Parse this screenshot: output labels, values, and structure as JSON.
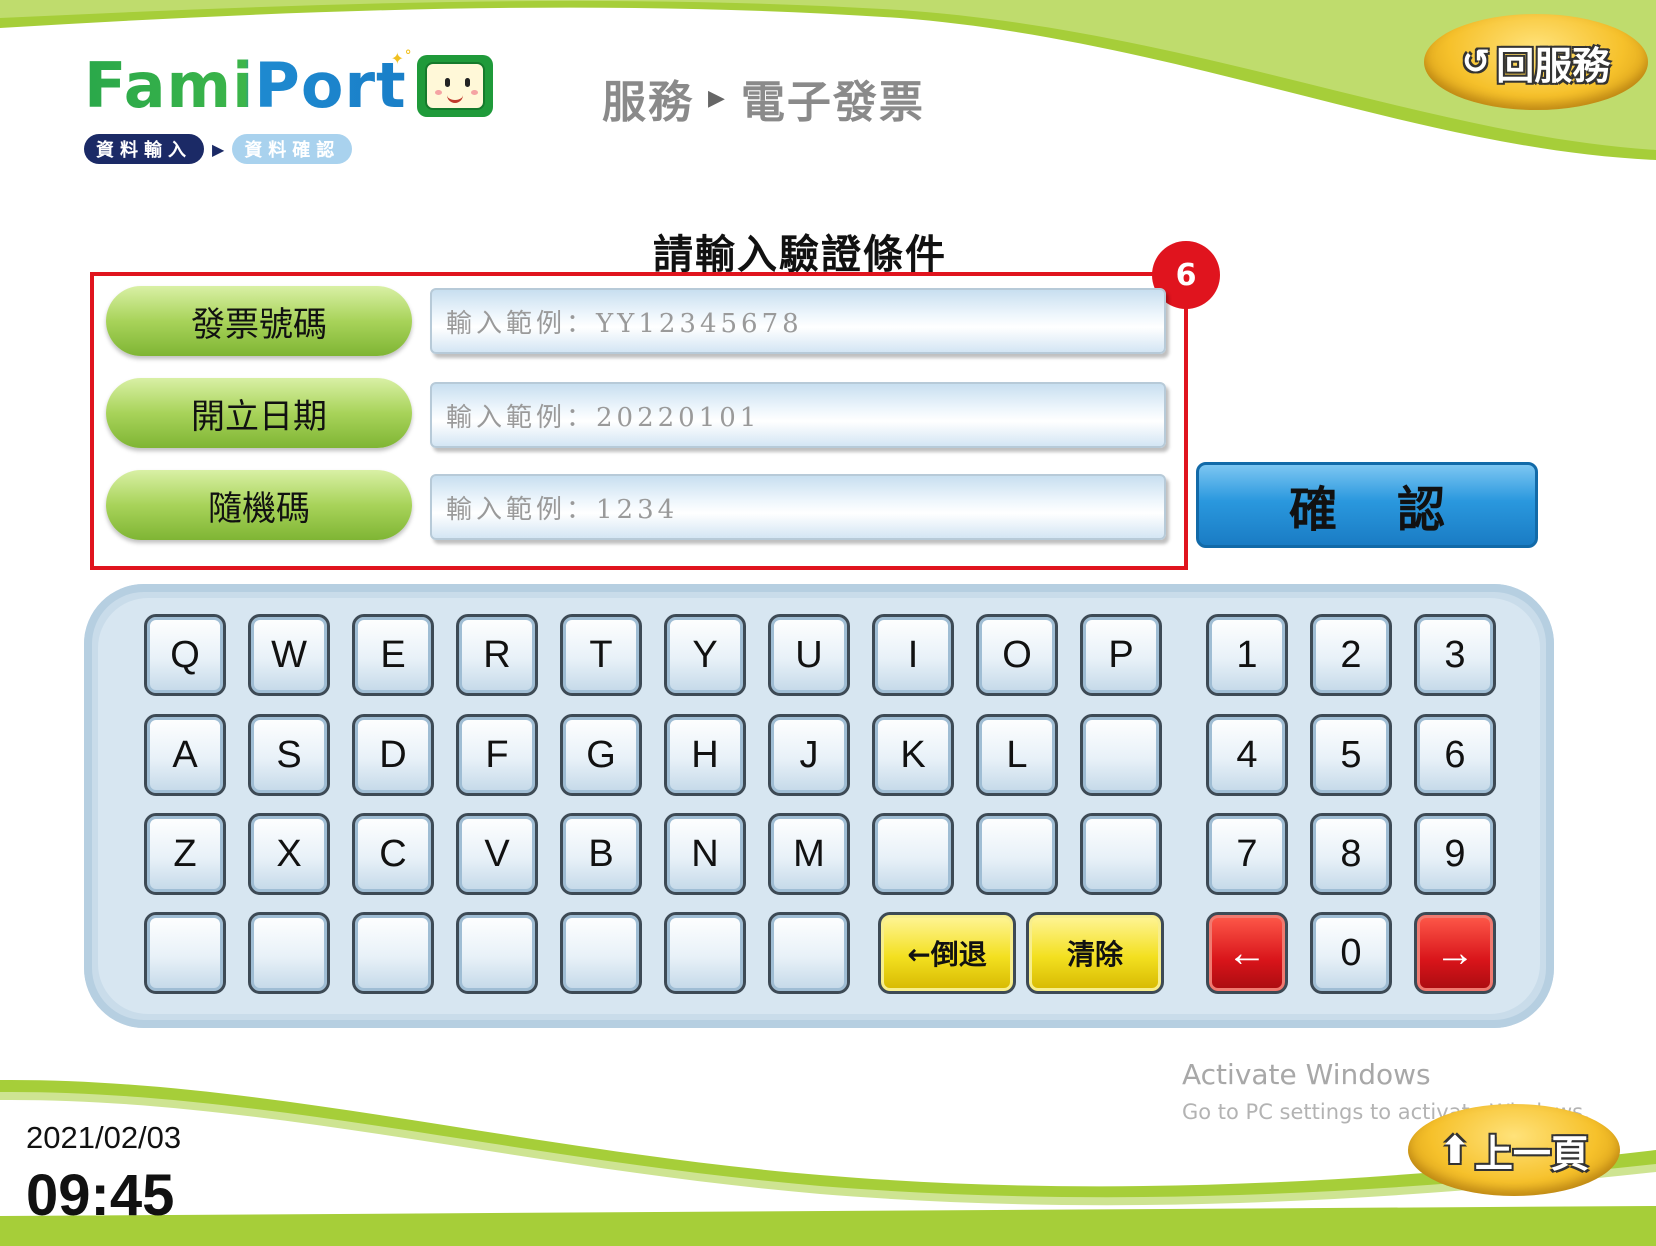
{
  "header": {
    "logo_text": "FamiPort",
    "breadcrumb": [
      "服務",
      "電子發票"
    ],
    "steps": [
      "資料輸入",
      "資料確認"
    ],
    "home_button": "回服務"
  },
  "form": {
    "title": "請輸入驗證條件",
    "badge": "6",
    "fields": [
      {
        "label": "發票號碼",
        "placeholder": "輸入範例：YY12345678"
      },
      {
        "label": "開立日期",
        "placeholder": "輸入範例：20220101"
      },
      {
        "label": "隨機碼",
        "placeholder": "輸入範例：1234"
      }
    ],
    "confirm": [
      "確",
      "認"
    ]
  },
  "keyboard": {
    "rows": [
      [
        "Q",
        "W",
        "E",
        "R",
        "T",
        "Y",
        "U",
        "I",
        "O",
        "P"
      ],
      [
        "A",
        "S",
        "D",
        "F",
        "G",
        "H",
        "J",
        "K",
        "L",
        ""
      ],
      [
        "Z",
        "X",
        "C",
        "V",
        "B",
        "N",
        "M",
        "",
        "",
        ""
      ],
      [
        "",
        "",
        "",
        "",
        "",
        "",
        ""
      ]
    ],
    "numpad": [
      [
        "1",
        "2",
        "3"
      ],
      [
        "4",
        "5",
        "6"
      ],
      [
        "7",
        "8",
        "9"
      ],
      [
        "←",
        "0",
        "→"
      ]
    ],
    "backspace": "←倒退",
    "clear": "清除"
  },
  "footer": {
    "date": "2021/02/03",
    "time": "09:45",
    "back_button": "上一頁",
    "watermark_title": "Activate Windows",
    "watermark_sub": "Go to PC settings to activate Windows."
  },
  "colors": {
    "green": "#8cc63f",
    "highlight": "#e0141e",
    "confirm_blue": "#2a98de",
    "key_yellow": "#f3e020",
    "key_red": "#d8141a",
    "gold": "#f6c12b"
  }
}
